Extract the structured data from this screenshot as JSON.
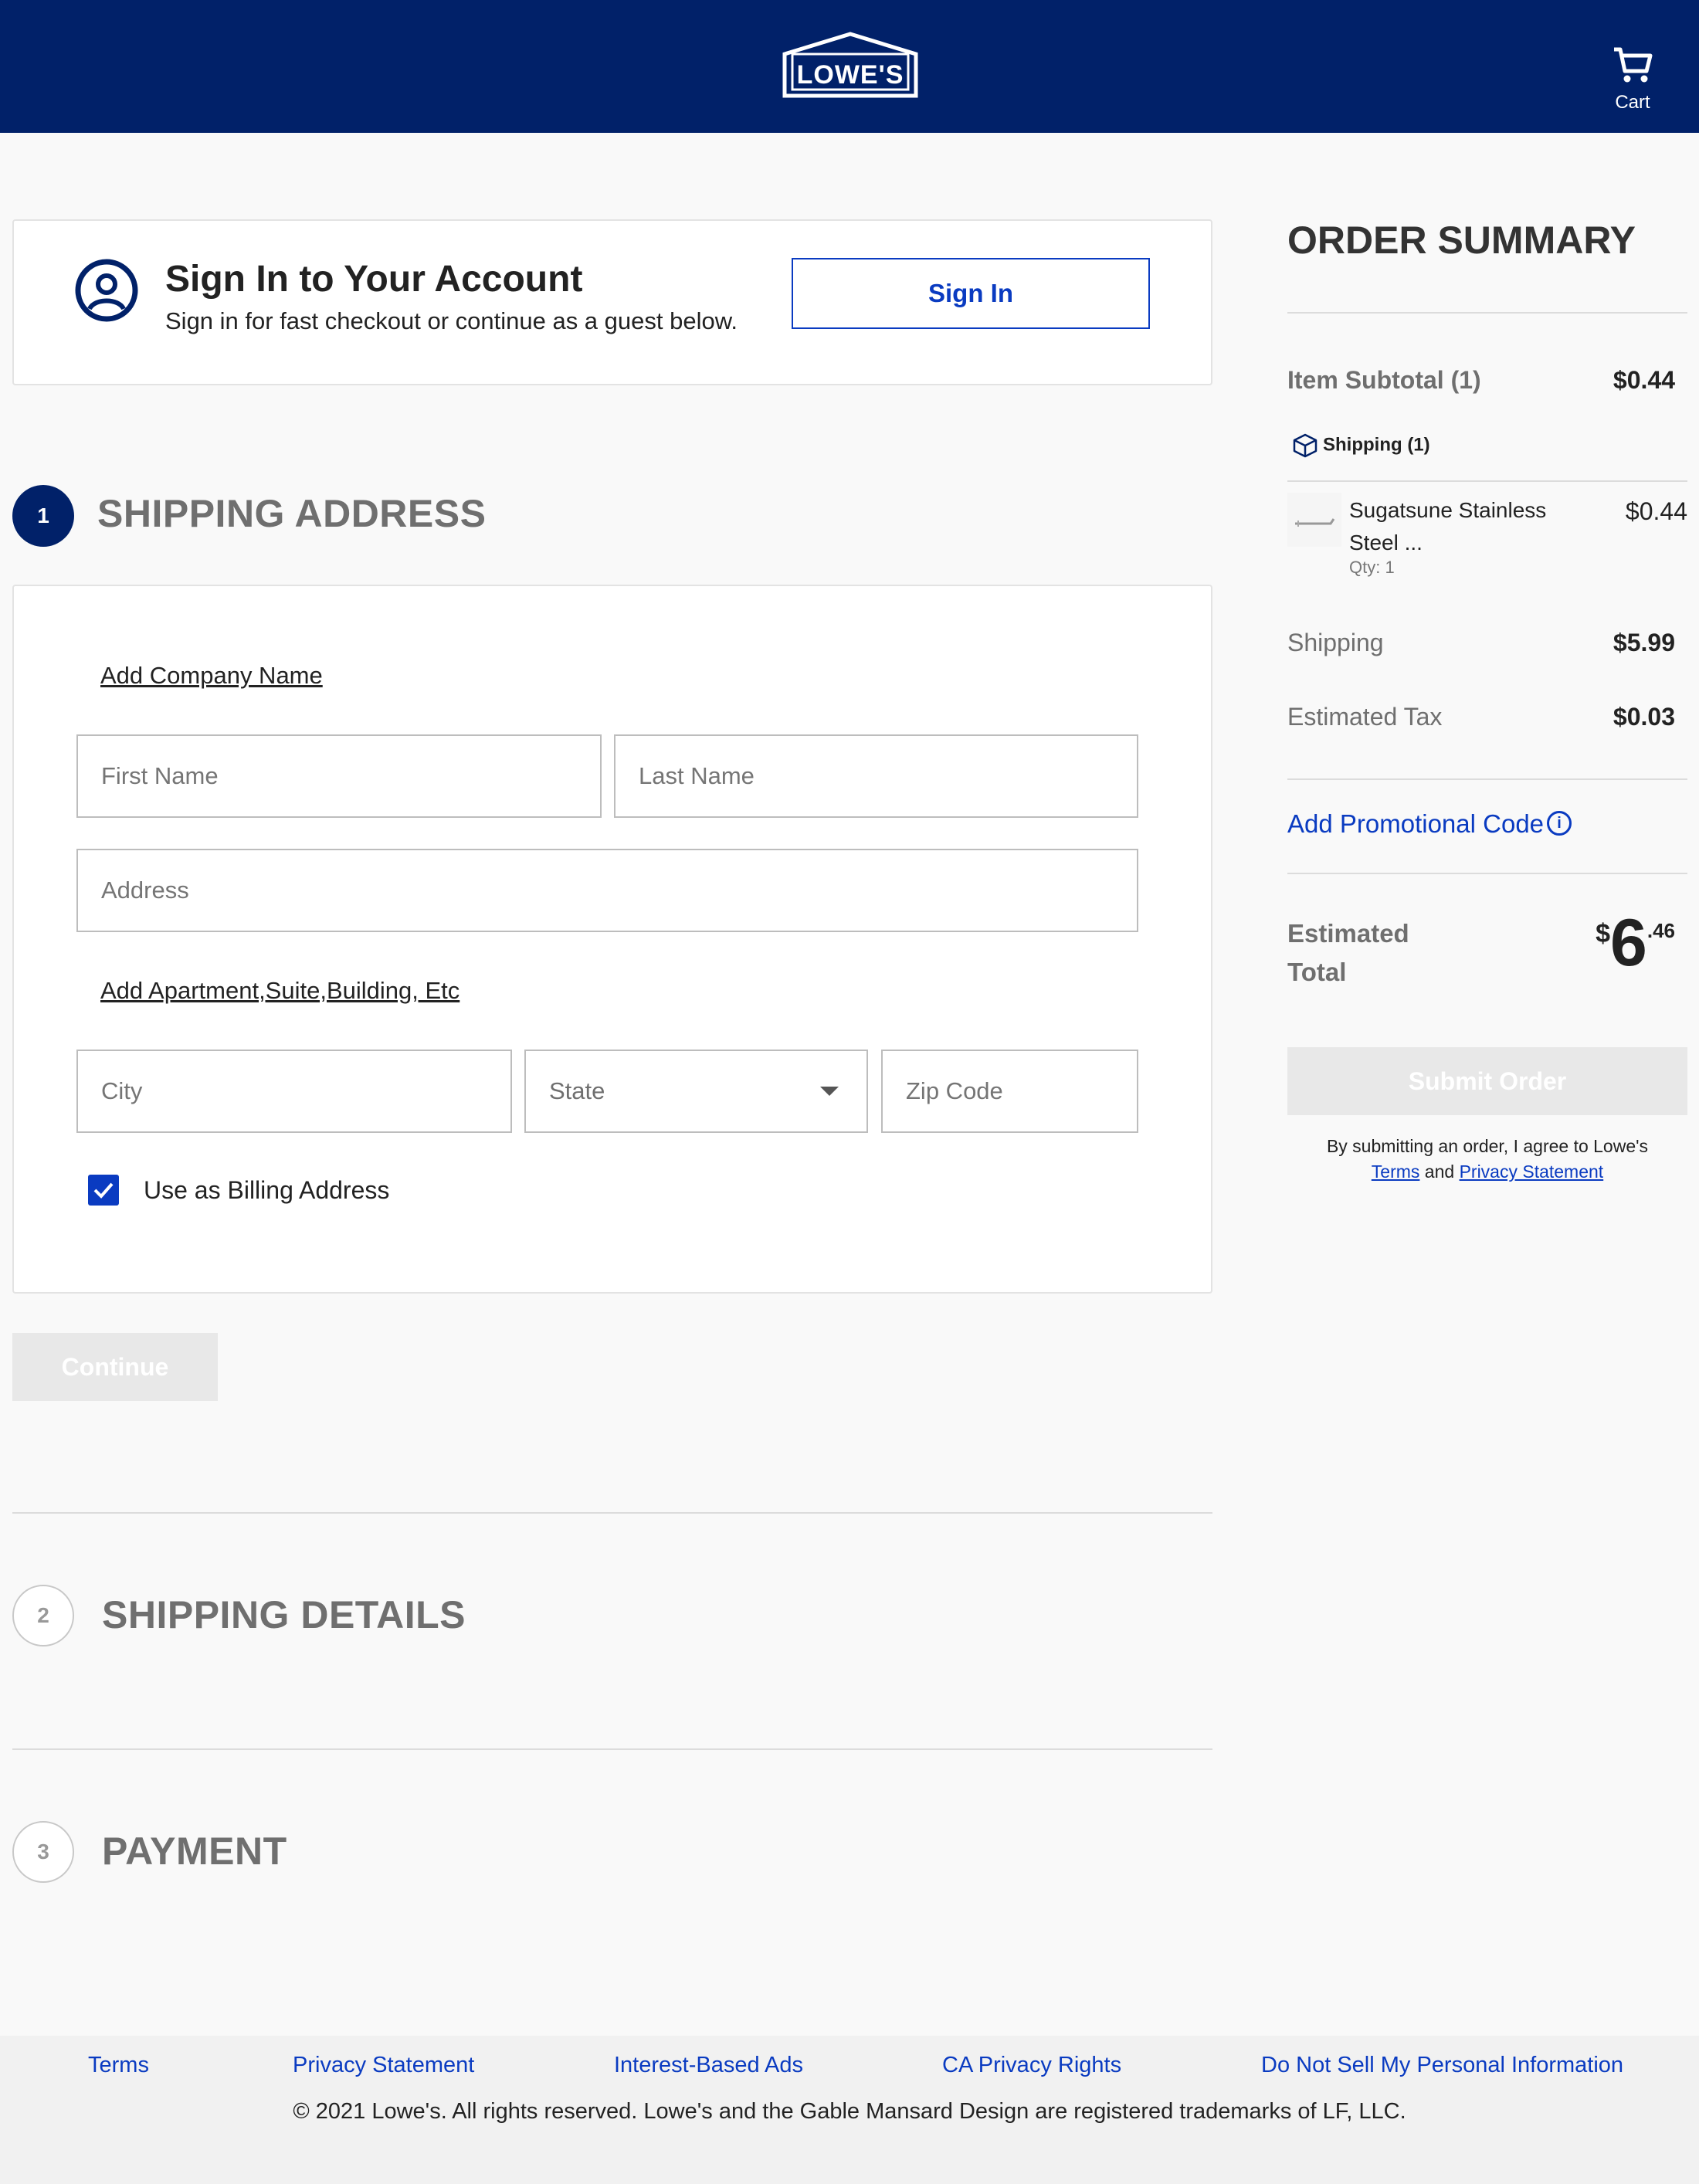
{
  "header": {
    "logo_text": "LOWE'S",
    "cart_label": "Cart"
  },
  "sign_in": {
    "title": "Sign In to Your Account",
    "subtitle": "Sign in for fast checkout or continue as a guest below.",
    "button": "Sign In"
  },
  "steps": [
    {
      "number": "1",
      "label": "SHIPPING ADDRESS"
    },
    {
      "number": "2",
      "label": "SHIPPING DETAILS"
    },
    {
      "number": "3",
      "label": "PAYMENT"
    }
  ],
  "address_form": {
    "add_company": "Add Company Name",
    "first_name_placeholder": "First Name",
    "last_name_placeholder": "Last Name",
    "address_placeholder": "Address",
    "add_apartment": "Add Apartment,Suite,Building, Etc",
    "city_placeholder": "City",
    "state_selected": "State",
    "zip_placeholder": "Zip Code",
    "billing_label": "Use as Billing Address",
    "billing_checked": true,
    "continue_button": "Continue"
  },
  "order_summary": {
    "title": "ORDER SUMMARY",
    "item_subtotal_label": "Item Subtotal (1)",
    "item_subtotal_value": "$0.44",
    "shipping_group": "Shipping (1)",
    "item": {
      "name": "Sugatsune Stainless Steel ...",
      "qty": "Qty: 1",
      "price": "$0.44"
    },
    "shipping_label": "Shipping",
    "shipping_value": "$5.99",
    "tax_label": "Estimated Tax",
    "tax_value": "$0.03",
    "promo_label": "Add Promotional Code",
    "estimated_total_label": "Estimated Total",
    "total_currency": "$",
    "total_dollars": "6",
    "total_cents": ".46",
    "submit_button": "Submit Order",
    "agree_prefix": "By submitting an order, I agree to Lowe's",
    "agree_terms": "Terms",
    "agree_and": "and",
    "agree_privacy": "Privacy Statement"
  },
  "footer": {
    "links": [
      "Terms",
      "Privacy Statement",
      "Interest-Based Ads",
      "CA Privacy Rights",
      "Do Not Sell My Personal Information"
    ],
    "copyright": "© 2021 Lowe's. All rights reserved. Lowe's and the Gable Mansard Design are registered trademarks of LF, LLC."
  },
  "colors": {
    "brand_navy": "#012169",
    "link_blue": "#0a3bc1",
    "disabled_gray": "#e8e8e8"
  }
}
